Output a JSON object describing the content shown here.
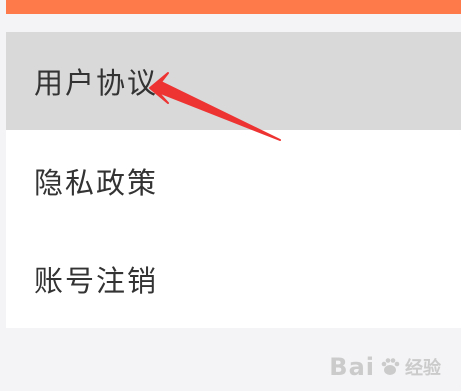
{
  "menu": {
    "items": [
      {
        "label": "用户协议",
        "selected": true
      },
      {
        "label": "隐私政策",
        "selected": false
      },
      {
        "label": "账号注销",
        "selected": false
      }
    ]
  },
  "watermark": {
    "text": "Bai",
    "sub": "经验"
  },
  "colors": {
    "top_bar": "#ff7a4a",
    "selected_row": "#d9d9d9",
    "arrow": "#ee3333"
  }
}
